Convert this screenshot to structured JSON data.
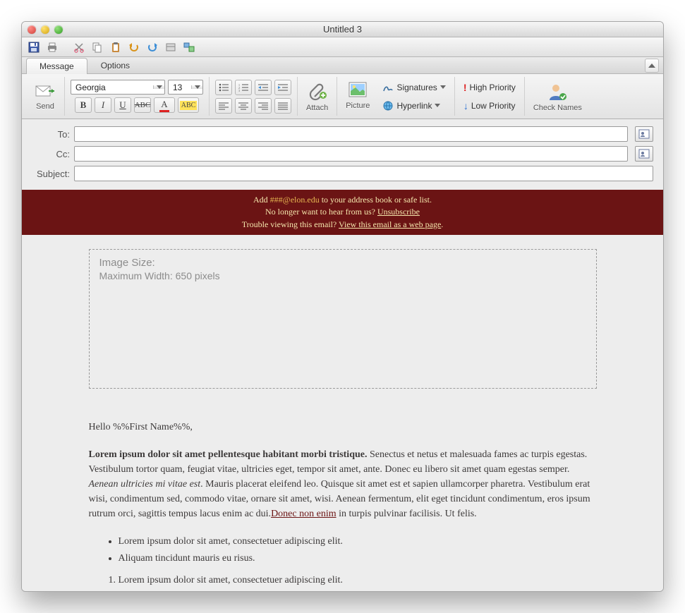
{
  "window": {
    "title": "Untitled 3"
  },
  "tabs": {
    "message": "Message",
    "options": "Options"
  },
  "ribbon": {
    "send": "Send",
    "font_name": "Georgia",
    "font_size": "13",
    "attach": "Attach",
    "picture": "Picture",
    "signatures": "Signatures",
    "hyperlink": "Hyperlink",
    "high_priority": "High Priority",
    "low_priority": "Low Priority",
    "check_names": "Check Names"
  },
  "fields": {
    "to_label": "To:",
    "cc_label": "Cc:",
    "subject_label": "Subject:",
    "to_value": "",
    "cc_value": "",
    "subject_value": ""
  },
  "banner": {
    "line1_pre": "Add ",
    "line1_acct": "###@elon.edu",
    "line1_post": " to your address book or safe list.",
    "line2_pre": "No longer want to hear from us? ",
    "line2_link": "Unsubscribe",
    "line3_pre": "Trouble viewing this email? ",
    "line3_link": "View this email as a web page",
    "line3_post": "."
  },
  "placeholder": {
    "heading": "Image Size:",
    "sub": "Maximum Width: 650 pixels"
  },
  "body": {
    "greeting": "Hello %%First Name%%,",
    "lead_bold": "Lorem ipsum dolor sit amet pellentesque habitant morbi tristique.",
    "p_seg1": " Senectus et netus et malesuada fames ac turpis egestas. Vestibulum tortor quam, feugiat vitae, ultricies eget, tempor sit amet, ante. Donec eu libero sit amet quam egestas semper. ",
    "p_em": "Aenean ultricies mi vitae est",
    "p_seg2": ". Mauris placerat eleifend leo. Quisque sit amet est et sapien ullamcorper pharetra. Vestibulum erat wisi, condimentum sed, commodo vitae, ornare sit amet, wisi. Aenean fermentum, elit eget tincidunt condimentum, eros ipsum rutrum orci, sagittis tempus lacus enim ac dui.",
    "p_link": "Donec non enim",
    "p_seg3": " in turpis pulvinar facilisis. Ut felis.",
    "ul1": "Lorem ipsum dolor sit amet, consectetuer adipiscing elit.",
    "ul2": "Aliquam tincidunt mauris eu risus.",
    "ol1": "Lorem ipsum dolor sit amet, consectetuer adipiscing elit."
  }
}
